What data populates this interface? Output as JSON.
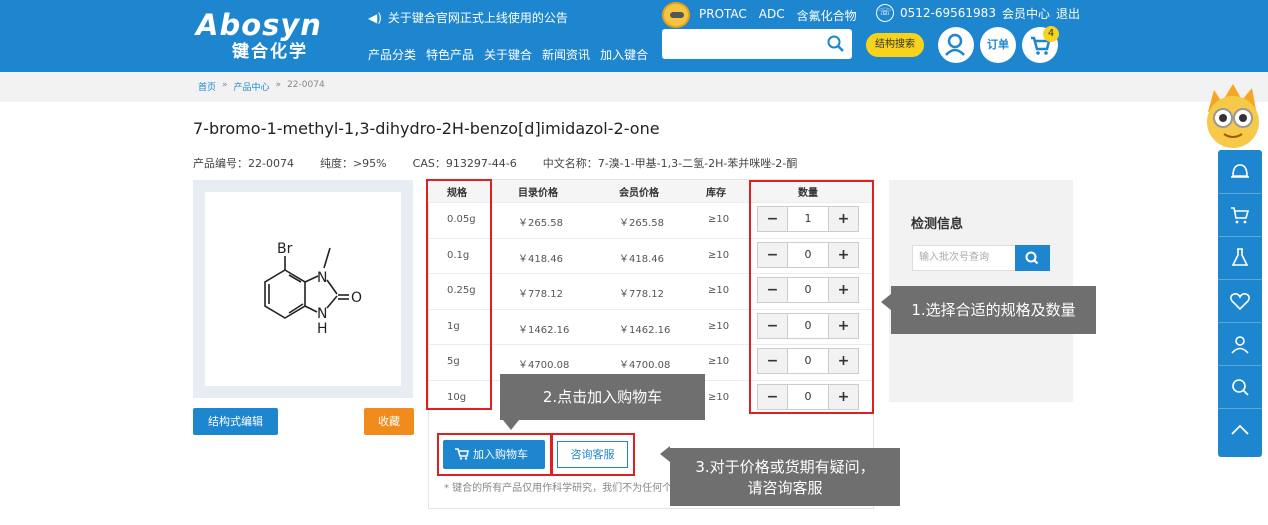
{
  "header": {
    "logo_top": "Abosyn",
    "logo_bottom": "键合化学",
    "notice": "关于键合官网正式上线使用的公告",
    "nav": [
      "产品分类",
      "特色产品",
      "关于键合",
      "新闻资讯",
      "加入键合"
    ],
    "toplinks": [
      "PROTAC",
      "ADC",
      "含氟化合物"
    ],
    "phone": "0512-69561983",
    "member": "会员中心",
    "logout": "退出",
    "struct_search": "结构搜索",
    "order": "订单",
    "cart_count": "4"
  },
  "breadcrumb": [
    "首页",
    "产品中心",
    "22-0074"
  ],
  "product": {
    "name": "7-bromo-1-methyl-1,3-dihydro-2H-benzo[d]imidazol-2-one",
    "code": "产品编号：22-0074",
    "purity": "纯度：>95%",
    "cas": "CAS：913297-44-6",
    "cn_name": "中文名称：7-溴-1-甲基-1,3-二氢-2H-苯并咪唑-2-酮"
  },
  "structure_labels": {
    "br": "Br",
    "n1": "N",
    "n2": "N",
    "h": "H",
    "o": "O"
  },
  "buttons": {
    "edit": "结构式编辑",
    "fav": "收藏",
    "cart": "加入购物车",
    "consult": "咨询客服"
  },
  "table": {
    "headers": [
      "规格",
      "目录价格",
      "会员价格",
      "库存",
      "数量"
    ],
    "rows": [
      {
        "spec": "0.05g",
        "list": "￥265.58",
        "member": "￥265.58",
        "stock": "≥10",
        "qty": "1"
      },
      {
        "spec": "0.1g",
        "list": "￥418.46",
        "member": "￥418.46",
        "stock": "≥10",
        "qty": "0"
      },
      {
        "spec": "0.25g",
        "list": "￥778.12",
        "member": "￥778.12",
        "stock": "≥10",
        "qty": "0"
      },
      {
        "spec": "1g",
        "list": "￥1462.16",
        "member": "￥1462.16",
        "stock": "≥10",
        "qty": "0"
      },
      {
        "spec": "5g",
        "list": "￥4700.08",
        "member": "￥4700.08",
        "stock": "≥10",
        "qty": "0"
      },
      {
        "spec": "10g",
        "list": "",
        "member": "",
        "stock": "≥10",
        "qty": "0"
      }
    ]
  },
  "disclaimer": "* 键合的所有产品仅用作科学研究，我们不为任何个人用途",
  "detect": {
    "title": "检测信息",
    "placeholder": "输入批次号查询"
  },
  "callouts": {
    "c1": "1.选择合适的规格及数量",
    "c2": "2.点击加入购物车",
    "c3a": "3.对于价格或货期有疑问，",
    "c3b": "请咨询客服"
  },
  "colors": {
    "primary": "#1e86cf",
    "orange": "#f18c1c",
    "highlight": "#e02020",
    "callout": "#6f6f6f"
  }
}
